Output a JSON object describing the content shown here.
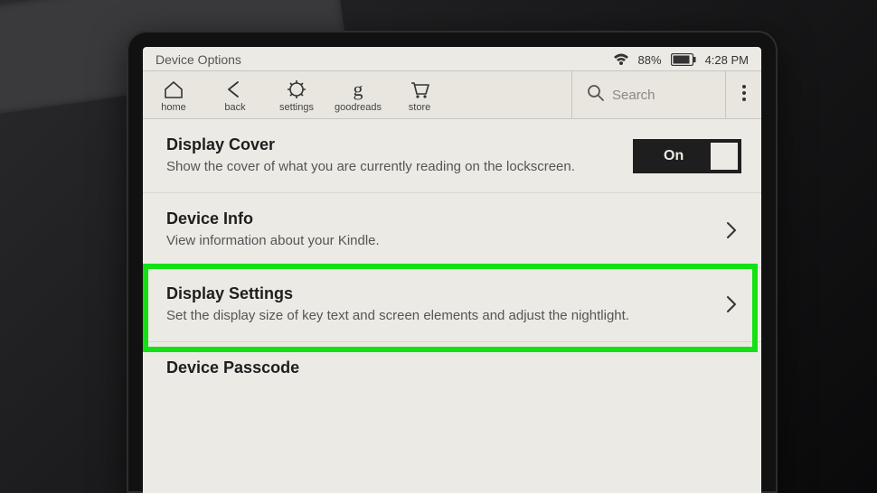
{
  "status": {
    "title": "Device Options",
    "battery_pct": "88%",
    "time": "4:28 PM"
  },
  "toolbar": {
    "items": [
      {
        "name": "home",
        "label": "home"
      },
      {
        "name": "back",
        "label": "back"
      },
      {
        "name": "settings",
        "label": "settings"
      },
      {
        "name": "goodreads",
        "label": "goodreads"
      },
      {
        "name": "store",
        "label": "store"
      }
    ],
    "search_placeholder": "Search"
  },
  "rows": {
    "display_cover": {
      "title": "Display Cover",
      "desc": "Show the cover of what you are currently reading on the lockscreen.",
      "toggle_label": "On",
      "toggle_state": true
    },
    "device_info": {
      "title": "Device Info",
      "desc": "View information about your Kindle."
    },
    "display_settings": {
      "title": "Display Settings",
      "desc": "Set the display size of key text and screen elements and adjust the nightlight."
    },
    "device_passcode": {
      "title": "Device Passcode"
    }
  }
}
